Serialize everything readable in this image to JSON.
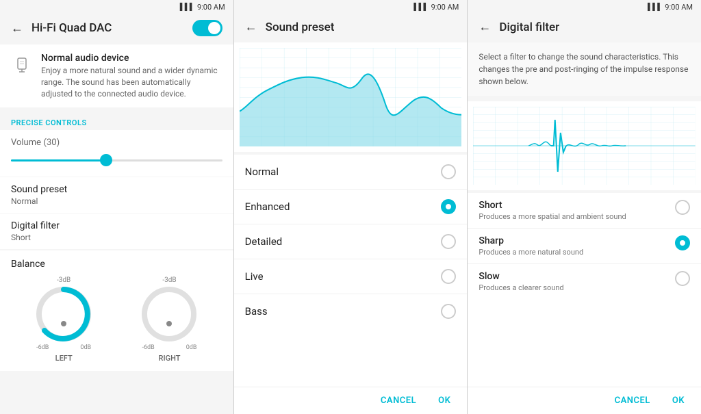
{
  "screen1": {
    "statusBar": {
      "time": "9:00 AM"
    },
    "header": {
      "title": "Hi-Fi Quad DAC",
      "back": "←"
    },
    "audioDevice": {
      "title": "Normal audio device",
      "description": "Enjoy a more natural sound and a wider dynamic range. The sound has been automatically adjusted to the connected audio device."
    },
    "preciseControls": {
      "label": "PRECISE CONTROLS"
    },
    "volume": {
      "label": "Volume",
      "value": "(30)"
    },
    "soundPreset": {
      "label": "Sound preset",
      "value": "Normal"
    },
    "digitalFilter": {
      "label": "Digital filter",
      "value": "Short"
    },
    "balance": {
      "label": "Balance"
    },
    "leftKnob": {
      "topLabel": "-3dB",
      "bottomLeft": "-6dB",
      "bottomRight": "0dB",
      "name": "LEFT"
    },
    "rightKnob": {
      "topLabel": "-3dB",
      "bottomLeft": "-6dB",
      "bottomRight": "0dB",
      "name": "RIGHT"
    }
  },
  "screen2": {
    "statusBar": {
      "time": "9:00 AM"
    },
    "header": {
      "title": "Sound preset",
      "back": "←"
    },
    "presets": [
      {
        "name": "Normal",
        "selected": false
      },
      {
        "name": "Enhanced",
        "selected": true
      },
      {
        "name": "Detailed",
        "selected": false
      },
      {
        "name": "Live",
        "selected": false
      },
      {
        "name": "Bass",
        "selected": false
      }
    ],
    "actions": {
      "cancel": "CANCEL",
      "ok": "OK"
    }
  },
  "screen3": {
    "statusBar": {
      "time": "9:00 AM"
    },
    "header": {
      "title": "Digital filter",
      "back": "←"
    },
    "description": "Select a filter to change the sound characteristics. This changes the pre and post-ringing of the impulse response shown below.",
    "filters": [
      {
        "name": "Short",
        "desc": "Produces a more spatial and ambient sound",
        "selected": false
      },
      {
        "name": "Sharp",
        "desc": "Produces a more natural sound",
        "selected": true
      },
      {
        "name": "Slow",
        "desc": "Produces a clearer sound",
        "selected": false
      }
    ],
    "actions": {
      "cancel": "CANCEL",
      "ok": "OK"
    }
  }
}
